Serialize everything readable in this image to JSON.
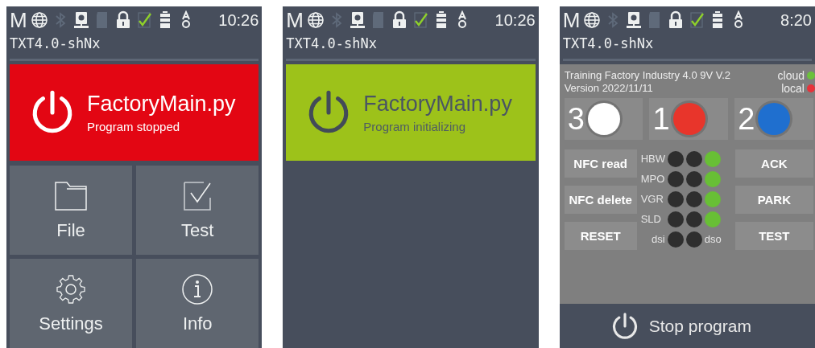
{
  "screens": [
    {
      "status_bar": {
        "mode": "M",
        "icons": [
          {
            "kind": "globe",
            "on": true
          },
          {
            "kind": "bluetooth",
            "on": false
          },
          {
            "kind": "camera",
            "on": true
          },
          {
            "kind": "sdcard",
            "on": false
          },
          {
            "kind": "lock",
            "on": true
          },
          {
            "kind": "check",
            "on": true
          },
          {
            "kind": "battery",
            "on": true
          },
          {
            "kind": "audio",
            "on": true
          }
        ],
        "time": "10:26"
      },
      "device_name": "TXT4.0-shNx",
      "program": {
        "name": "FactoryMain.py",
        "status_text": "Program stopped",
        "kind": "stopped"
      },
      "tiles": [
        {
          "label": "File",
          "kind": "folder"
        },
        {
          "label": "Test",
          "kind": "test"
        },
        {
          "label": "Settings",
          "kind": "settings"
        },
        {
          "label": "Info",
          "kind": "info"
        }
      ]
    },
    {
      "status_bar": {
        "mode": "M",
        "icons": [
          {
            "kind": "globe",
            "on": true
          },
          {
            "kind": "bluetooth",
            "on": false
          },
          {
            "kind": "camera",
            "on": true
          },
          {
            "kind": "sdcard",
            "on": false
          },
          {
            "kind": "lock",
            "on": true
          },
          {
            "kind": "check",
            "on": true
          },
          {
            "kind": "battery",
            "on": true
          },
          {
            "kind": "audio",
            "on": true
          }
        ],
        "time": "10:26"
      },
      "device_name": "TXT4.0-shNx",
      "program": {
        "name": "FactoryMain.py",
        "status_text": "Program initializing",
        "kind": "initializing"
      }
    },
    {
      "status_bar": {
        "mode": "M",
        "icons": [
          {
            "kind": "globe",
            "on": true
          },
          {
            "kind": "bluetooth",
            "on": false
          },
          {
            "kind": "camera",
            "on": true
          },
          {
            "kind": "sdcard",
            "on": false
          },
          {
            "kind": "lock",
            "on": true
          },
          {
            "kind": "check",
            "on": true
          },
          {
            "kind": "battery",
            "on": true
          },
          {
            "kind": "audio",
            "on": true
          }
        ],
        "time": "8:20"
      },
      "device_name": "TXT4.0-shNx",
      "factory_panel": {
        "title": "Training Factory Industry 4.0 9V V.2",
        "version": "Version 2022/11/11",
        "connections": [
          {
            "label": "cloud",
            "color": "#6cc13c"
          },
          {
            "label": "local",
            "color": "#e8323a"
          }
        ],
        "color_buttons": [
          {
            "label": "3",
            "color": "#ffffff"
          },
          {
            "label": "1",
            "color": "#e8352b"
          },
          {
            "label": "2",
            "color": "#1f6fcf"
          }
        ],
        "left_buttons": [
          "NFC read",
          "NFC delete",
          "RESET"
        ],
        "modules": [
          {
            "label": "HBW",
            "leds": [
              false,
              false,
              true
            ]
          },
          {
            "label": "MPO",
            "leds": [
              false,
              false,
              true
            ]
          },
          {
            "label": "VGR",
            "leds": [
              false,
              false,
              true
            ]
          },
          {
            "label": "SLD",
            "leds": [
              false,
              false,
              true
            ]
          }
        ],
        "io": {
          "in_label": "dsi",
          "out_label": "dso",
          "leds": [
            false,
            false
          ]
        },
        "right_buttons": [
          "ACK",
          "PARK",
          "TEST"
        ]
      },
      "stop_button": "Stop program"
    }
  ]
}
